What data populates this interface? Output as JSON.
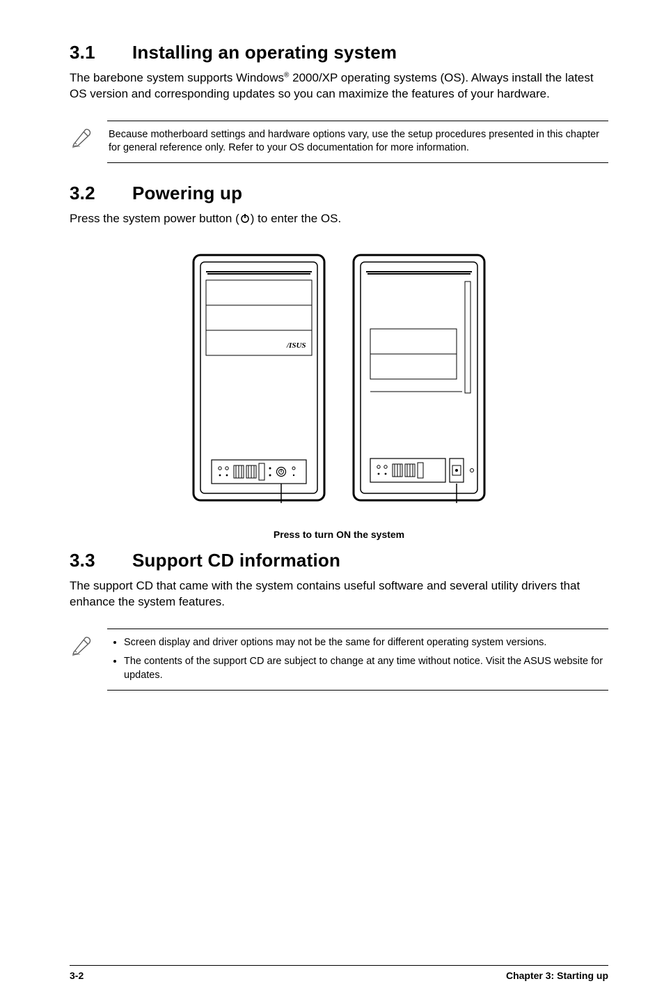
{
  "section31": {
    "num": "3.1",
    "title": "Installing an operating system",
    "body_pre": "The barebone system supports Windows",
    "body_sup": "®",
    "body_post": " 2000/XP operating systems (OS). Always install the latest OS version and corresponding updates so you can maximize the features of your hardware.",
    "note": "Because motherboard settings and hardware options vary, use the setup procedures presented in this chapter for general reference only. Refer to your OS documentation for more information."
  },
  "section32": {
    "num": "3.2",
    "title": "Powering up",
    "body_pre": "Press the system power button (",
    "body_post": ") to enter the OS.",
    "caption": "Press to turn ON the system"
  },
  "section33": {
    "num": "3.3",
    "title": "Support CD information",
    "body": "The support CD that came with the system contains useful software and several utility drivers that enhance the system features.",
    "notes": [
      "Screen display and driver options may not be the same for different operating system versions.",
      "The contents of the support CD are subject to change at any time without notice. Visit the ASUS website for updates."
    ]
  },
  "footer": {
    "left": "3-2",
    "right": "Chapter 3: Starting up"
  }
}
